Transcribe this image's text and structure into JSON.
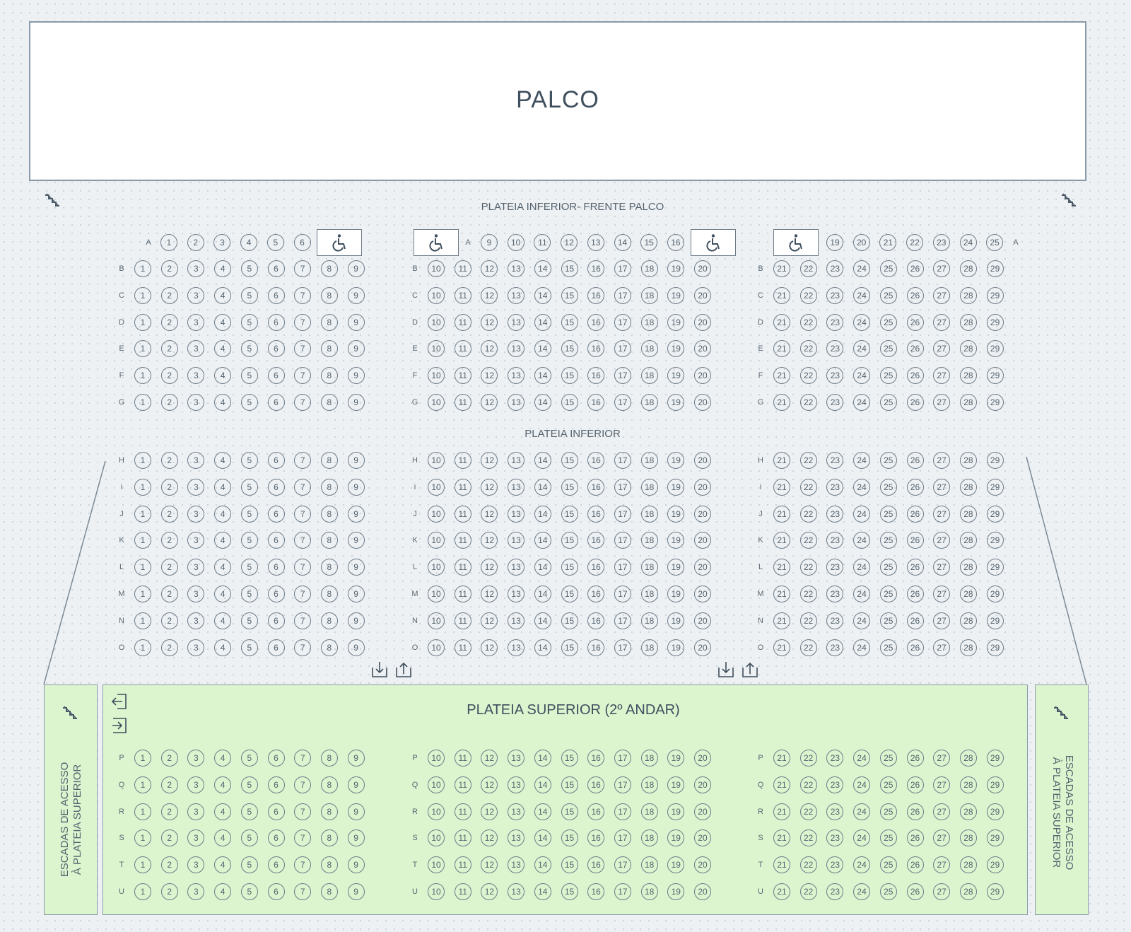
{
  "stage": {
    "label": "PALCO"
  },
  "sections": {
    "front_title": "PLATEIA INFERIOR- FRENTE PALCO",
    "lower_title": "PLATEIA INFERIOR",
    "upper_title": "PLATEIA SUPERIOR (2º ANDAR)"
  },
  "stairs_panel": {
    "left_label": "ESCADAS DE ACESSO\nÀ PLATEIA SUPERIOR",
    "right_label": "ESCADAS DE ACESSO\nÀ PLATEIA SUPERIOR"
  },
  "row_a": {
    "label": "A",
    "left_seats": [
      "1",
      "2",
      "3",
      "4",
      "5",
      "6"
    ],
    "center_seats": [
      "9",
      "10",
      "11",
      "12",
      "13",
      "14",
      "15",
      "16"
    ],
    "right_seats": [
      "19",
      "20",
      "21",
      "22",
      "23",
      "24",
      "25"
    ]
  },
  "front_rows": [
    "B",
    "C",
    "D",
    "E",
    "F",
    "G"
  ],
  "lower_rows": [
    "H",
    "i",
    "J",
    "K",
    "L",
    "M",
    "N",
    "O"
  ],
  "upper_rows": [
    "P",
    "Q",
    "R",
    "S",
    "T",
    "U"
  ],
  "blocks": {
    "left": [
      "1",
      "2",
      "3",
      "4",
      "5",
      "6",
      "7",
      "8",
      "9"
    ],
    "center": [
      "10",
      "11",
      "12",
      "13",
      "14",
      "15",
      "16",
      "17",
      "18",
      "19",
      "20"
    ],
    "right": [
      "21",
      "22",
      "23",
      "24",
      "25",
      "26",
      "27",
      "28",
      "29"
    ]
  },
  "icons": {
    "wheelchair": "wheelchair-icon",
    "stairs": "stairs-icon",
    "exit_down": "download-tray-icon",
    "exit_up": "upload-tray-icon",
    "enter": "login-arrow-icon",
    "leave": "logout-arrow-icon"
  },
  "colors": {
    "upper_fill": "#dcf5cf",
    "stage_fill": "#ffffff",
    "seat_stroke": "#6d7b88"
  }
}
